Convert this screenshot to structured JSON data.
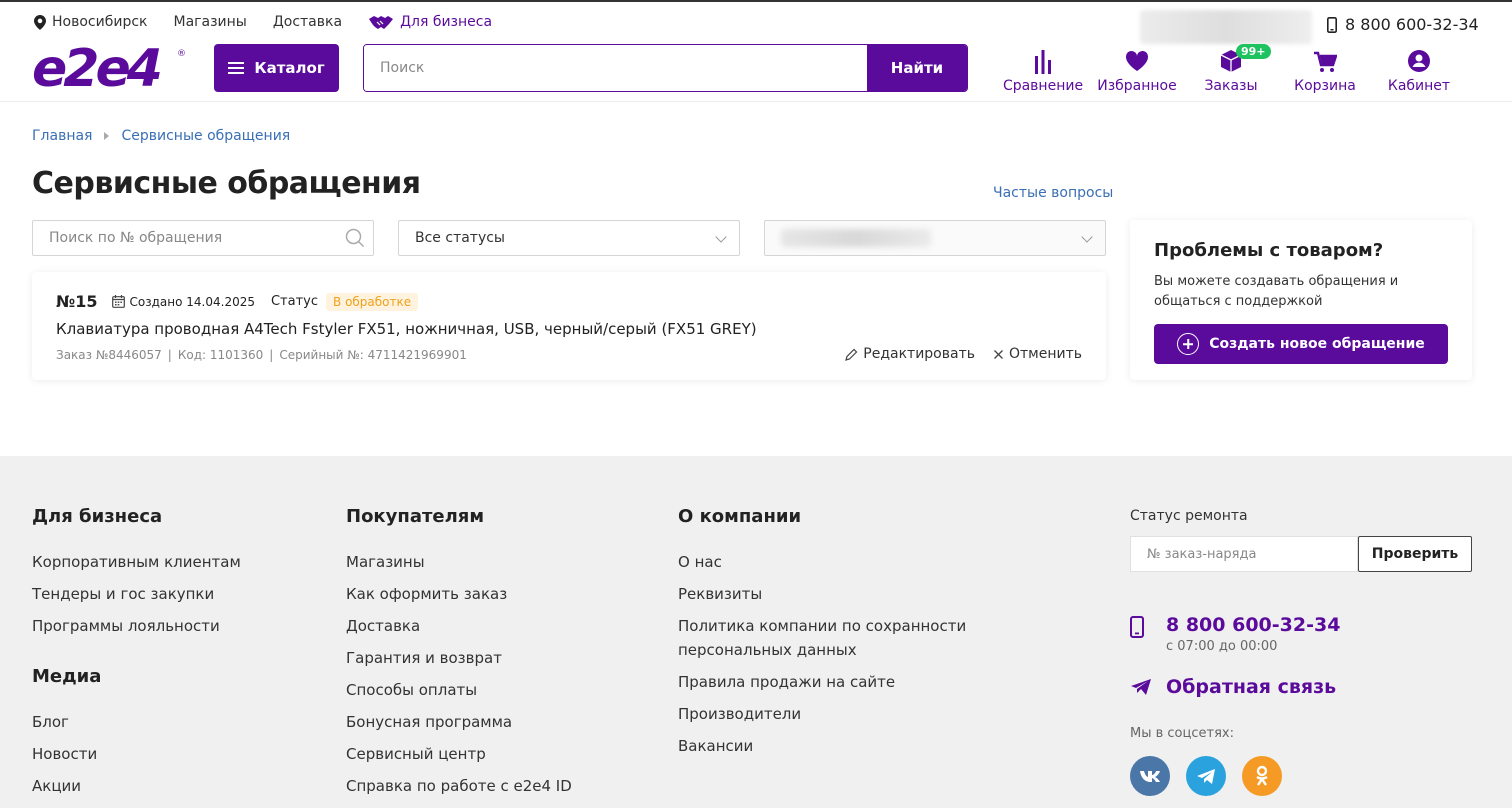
{
  "top": {
    "city": "Новосибирск",
    "stores": "Магазины",
    "delivery": "Доставка",
    "business": "Для бизнеса",
    "phone": "8 800 600-32-34"
  },
  "header": {
    "catalog": "Каталог",
    "search_placeholder": "Поиск",
    "search_button": "Найти",
    "icons": {
      "compare": "Сравнение",
      "favorites": "Избранное",
      "orders": "Заказы",
      "orders_badge": "99+",
      "cart": "Корзина",
      "account": "Кабинет"
    }
  },
  "breadcrumb": {
    "home": "Главная",
    "current": "Сервисные обращения"
  },
  "page": {
    "title": "Сервисные обращения",
    "faq": "Частые вопросы",
    "search_placeholder": "Поиск по № обращения",
    "status_filter": "Все статусы"
  },
  "ticket": {
    "number": "№15",
    "created": "Создано 14.04.2025",
    "status_label": "Статус",
    "status": "В обработке",
    "title": "Клавиатура проводная A4Tech Fstyler FX51, ножничная, USB, черный/серый (FX51 GREY)",
    "order": "Заказ №8446057",
    "code": "Код: 1101360",
    "serial": "Серийный №: 4711421969901",
    "edit": "Редактировать",
    "cancel": "Отменить"
  },
  "side": {
    "heading": "Проблемы с товаром?",
    "text": "Вы можете создавать обращения и общаться с поддержкой",
    "button": "Создать новое обращение"
  },
  "footer": {
    "business": {
      "title": "Для бизнеса",
      "links": [
        "Корпоративным клиентам",
        "Тендеры и гос закупки",
        "Программы лояльности"
      ]
    },
    "media": {
      "title": "Медиа",
      "links": [
        "Блог",
        "Новости",
        "Акции"
      ]
    },
    "buyers": {
      "title": "Покупателям",
      "links": [
        "Магазины",
        "Как оформить заказ",
        "Доставка",
        "Гарантия и возврат",
        "Способы оплаты",
        "Бонусная программа",
        "Сервисный центр",
        "Справка по работе с e2e4 ID"
      ]
    },
    "company": {
      "title": "О компании",
      "links": [
        "О нас",
        "Реквизиты",
        "Политика компании по сохранности персональных данных",
        "Правила продажи на сайте",
        "Производители",
        "Вакансии"
      ]
    },
    "repair_status": "Статус ремонта",
    "repair_placeholder": "№ заказ-наряда",
    "repair_button": "Проверить",
    "phone": "8 800 600-32-34",
    "hours": "с 07:00 до 00:00",
    "feedback": "Обратная связь",
    "socials_label": "Мы в соцсетях:"
  },
  "colors": {
    "brand": "#5b0b9c",
    "link": "#3a6fb5",
    "status_bg": "#fff3df",
    "status_fg": "#f0a11b",
    "badge": "#1ec35f"
  }
}
